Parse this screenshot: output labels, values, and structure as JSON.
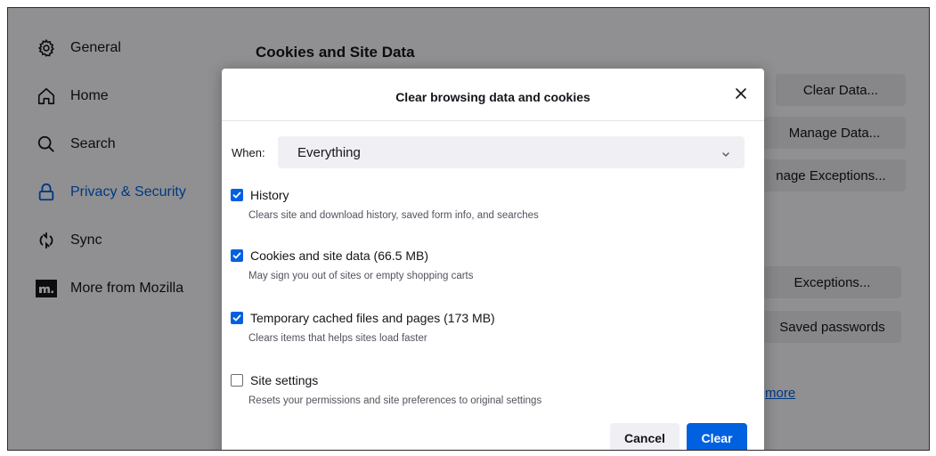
{
  "sidebar": {
    "items": [
      {
        "label": "General",
        "icon": "gear-icon"
      },
      {
        "label": "Home",
        "icon": "home-icon"
      },
      {
        "label": "Search",
        "icon": "search-icon"
      },
      {
        "label": "Privacy & Security",
        "icon": "lock-icon",
        "active": true
      },
      {
        "label": "Sync",
        "icon": "sync-icon"
      },
      {
        "label": "More from Mozilla",
        "icon": "mozilla-icon"
      }
    ]
  },
  "main": {
    "section_title": "Cookies and Site Data",
    "buttons": {
      "clear_data": "Clear Data...",
      "manage_data": "Manage Data...",
      "manage_exceptions": "nage Exceptions...",
      "exceptions": "Exceptions...",
      "saved_passwords": "Saved passwords"
    },
    "learn_more": "more"
  },
  "dialog": {
    "title": "Clear browsing data and cookies",
    "when_label": "When:",
    "when_value": "Everything",
    "options": [
      {
        "label": "History",
        "description": "Clears site and download history, saved form info, and searches",
        "checked": true
      },
      {
        "label": "Cookies and site data (66.5 MB)",
        "description": "May sign you out of sites or empty shopping carts",
        "checked": true
      },
      {
        "label": "Temporary cached files and pages (173 MB)",
        "description": "Clears items that helps sites load faster",
        "checked": true
      },
      {
        "label": "Site settings",
        "description": "Resets your permissions and site preferences to original settings",
        "checked": false
      }
    ],
    "cancel_label": "Cancel",
    "clear_label": "Clear"
  },
  "colors": {
    "accent": "#0061e0",
    "overlay": "rgba(0,0,0,0.42)"
  }
}
